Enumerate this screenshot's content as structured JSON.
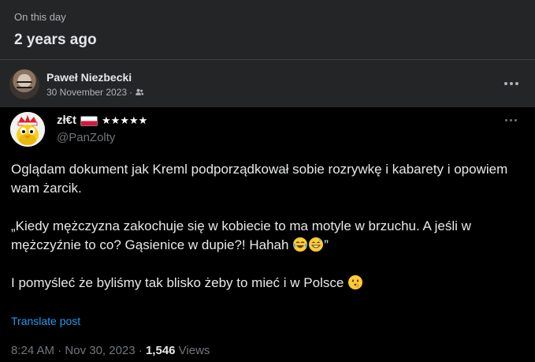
{
  "memory": {
    "kicker": "On this day",
    "title": "2 years ago"
  },
  "post": {
    "author": "Paweł Niezbecki",
    "date": "30 November 2023",
    "meta_separator": "·",
    "audience_icon": "friends-icon"
  },
  "tweet": {
    "display_name": "zł€t",
    "stars": "★★★★★",
    "handle": "@PanZolty",
    "paragraph1": "Oglądam dokument jak Kreml podporządkował sobie rozrywkę i kabarety i opowiem wam żarcik.",
    "paragraph2": "„Kiedy mężczyzna zakochuje się w kobiecie to ma motyle w brzuchu. A jeśli w mężczyźnie to co? Gąsienice w dupie?! Hahah",
    "paragraph2_end": "”",
    "paragraph3": "I pomyśleć że byliśmy tak blisko żeby to mieć i w Polsce",
    "translate_label": "Translate post",
    "time": "8:24 AM",
    "footer_sep1": " · ",
    "date": "Nov 30, 2023",
    "footer_sep2": " · ",
    "views_count": "1,546",
    "views_label": " Views",
    "emojis": [
      "tears-of-joy-icon",
      "grinning-sweat-icon",
      "shushing-face-icon"
    ]
  },
  "colors": {
    "facebook_card_bg": "#242526",
    "tweet_bg": "#000000",
    "link_blue": "#1d9bf0",
    "muted_text": "#71767b"
  }
}
